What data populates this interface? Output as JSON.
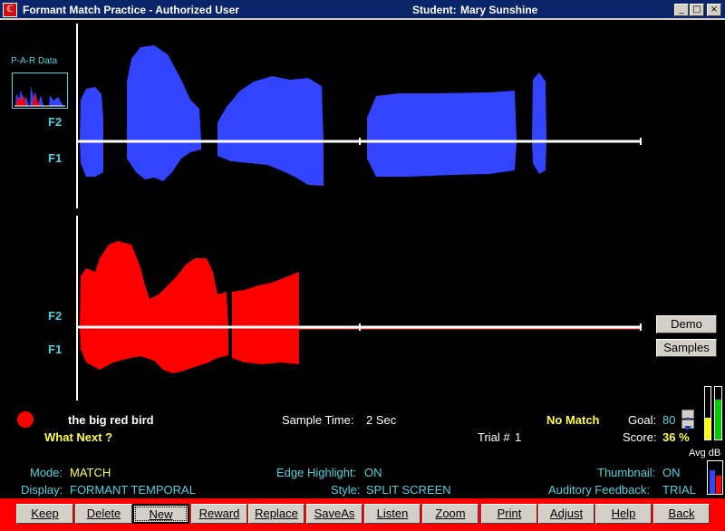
{
  "window": {
    "title": "Formant Match Practice - Authorized User",
    "student_label": "Student:",
    "student_name": "Mary Sunshine",
    "minimize": "_",
    "maximize": "□",
    "close": "×",
    "app_icon": "ℂ"
  },
  "thumbnail": {
    "label": "P-A-R Data"
  },
  "plots": {
    "top": {
      "f2": "F2",
      "f1": "F1",
      "color": "#3344ff"
    },
    "bottom": {
      "f2": "F2",
      "f1": "F1",
      "color": "#ff0000"
    }
  },
  "side_buttons": {
    "demo": "Demo",
    "samples": "Samples"
  },
  "info": {
    "phrase": "the big red bird",
    "what_next": "What Next ?",
    "sample_time_label": "Sample Time:",
    "sample_time_value": "2  Sec",
    "match_status": "No Match",
    "trial_label": "Trial #",
    "trial_value": "1",
    "goal_label": "Goal:",
    "goal_value": "80",
    "score_label": "Score:",
    "score_value": "36 %",
    "avg_db": "Avg dB"
  },
  "settings": {
    "mode_label": "Mode:",
    "mode_value": "MATCH",
    "display_label": "Display:",
    "display_value": "FORMANT  TEMPORAL",
    "edge_label": "Edge Highlight:",
    "edge_value": "ON",
    "style_label": "Style:",
    "style_value": "SPLIT SCREEN",
    "thumbnail_label": "Thumbnail:",
    "thumbnail_value": "ON",
    "auditory_label": "Auditory  Feedback:",
    "auditory_value": "TRIAL"
  },
  "toolbar": {
    "keep": "Keep",
    "delete": "Delete",
    "new": "New",
    "reward": "Reward",
    "replace": "Replace",
    "saveas": "SaveAs",
    "listen": "Listen",
    "zoom": "Zoom",
    "print": "Print",
    "adjust": "Adjust",
    "help": "Help",
    "back": "Back"
  },
  "icons": [
    "app-icon",
    "minimize-icon",
    "maximize-icon",
    "close-icon",
    "spin-up-icon",
    "spin-down-icon",
    "record-indicator-icon"
  ]
}
